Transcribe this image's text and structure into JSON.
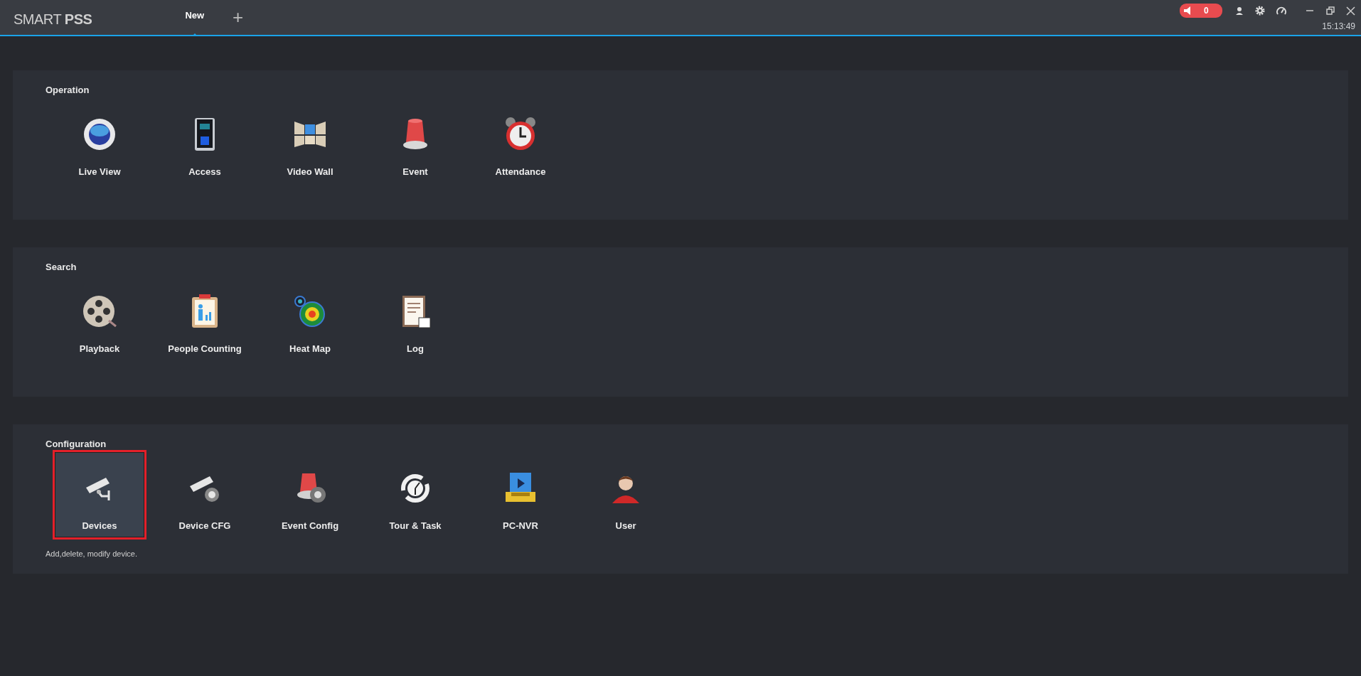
{
  "app": {
    "title": "SMART **PSS**"
  },
  "tabs": [
    {
      "label": "New",
      "selected": true
    }
  ],
  "add_tab": "+",
  "header": {
    "alarm_count": "0",
    "time": "15:13:49"
  },
  "sections": [
    {
      "title": "Operation",
      "items": [
        {
          "label": "Live View",
          "kind": "liveview",
          "selected": false
        },
        {
          "label": "Access",
          "kind": "access",
          "selected": false
        },
        {
          "label": "Video Wall",
          "kind": "videowall",
          "selected": false
        },
        {
          "label": "Event",
          "kind": "event",
          "selected": false
        },
        {
          "label": "Attendance",
          "kind": "attendance",
          "selected": false
        }
      ]
    },
    {
      "title": "Search",
      "items": [
        {
          "label": "Playback",
          "kind": "playback",
          "selected": false
        },
        {
          "label": "People Counting",
          "kind": "people",
          "selected": false
        },
        {
          "label": "Heat Map",
          "kind": "heatmap",
          "selected": false
        },
        {
          "label": "Log",
          "kind": "log",
          "selected": false
        }
      ]
    },
    {
      "title": "Configuration",
      "description": "Add,delete, modify device.",
      "items": [
        {
          "label": "Devices",
          "kind": "devices",
          "selected": true
        },
        {
          "label": "Device CFG",
          "kind": "devicecfg",
          "selected": false
        },
        {
          "label": "Event Config",
          "kind": "eventconfig",
          "selected": false
        },
        {
          "label": "Tour & Task",
          "kind": "tour",
          "selected": false
        },
        {
          "label": "PC-NVR",
          "kind": "pcnvr",
          "selected": false
        },
        {
          "label": "User",
          "kind": "user",
          "selected": false
        }
      ]
    }
  ]
}
